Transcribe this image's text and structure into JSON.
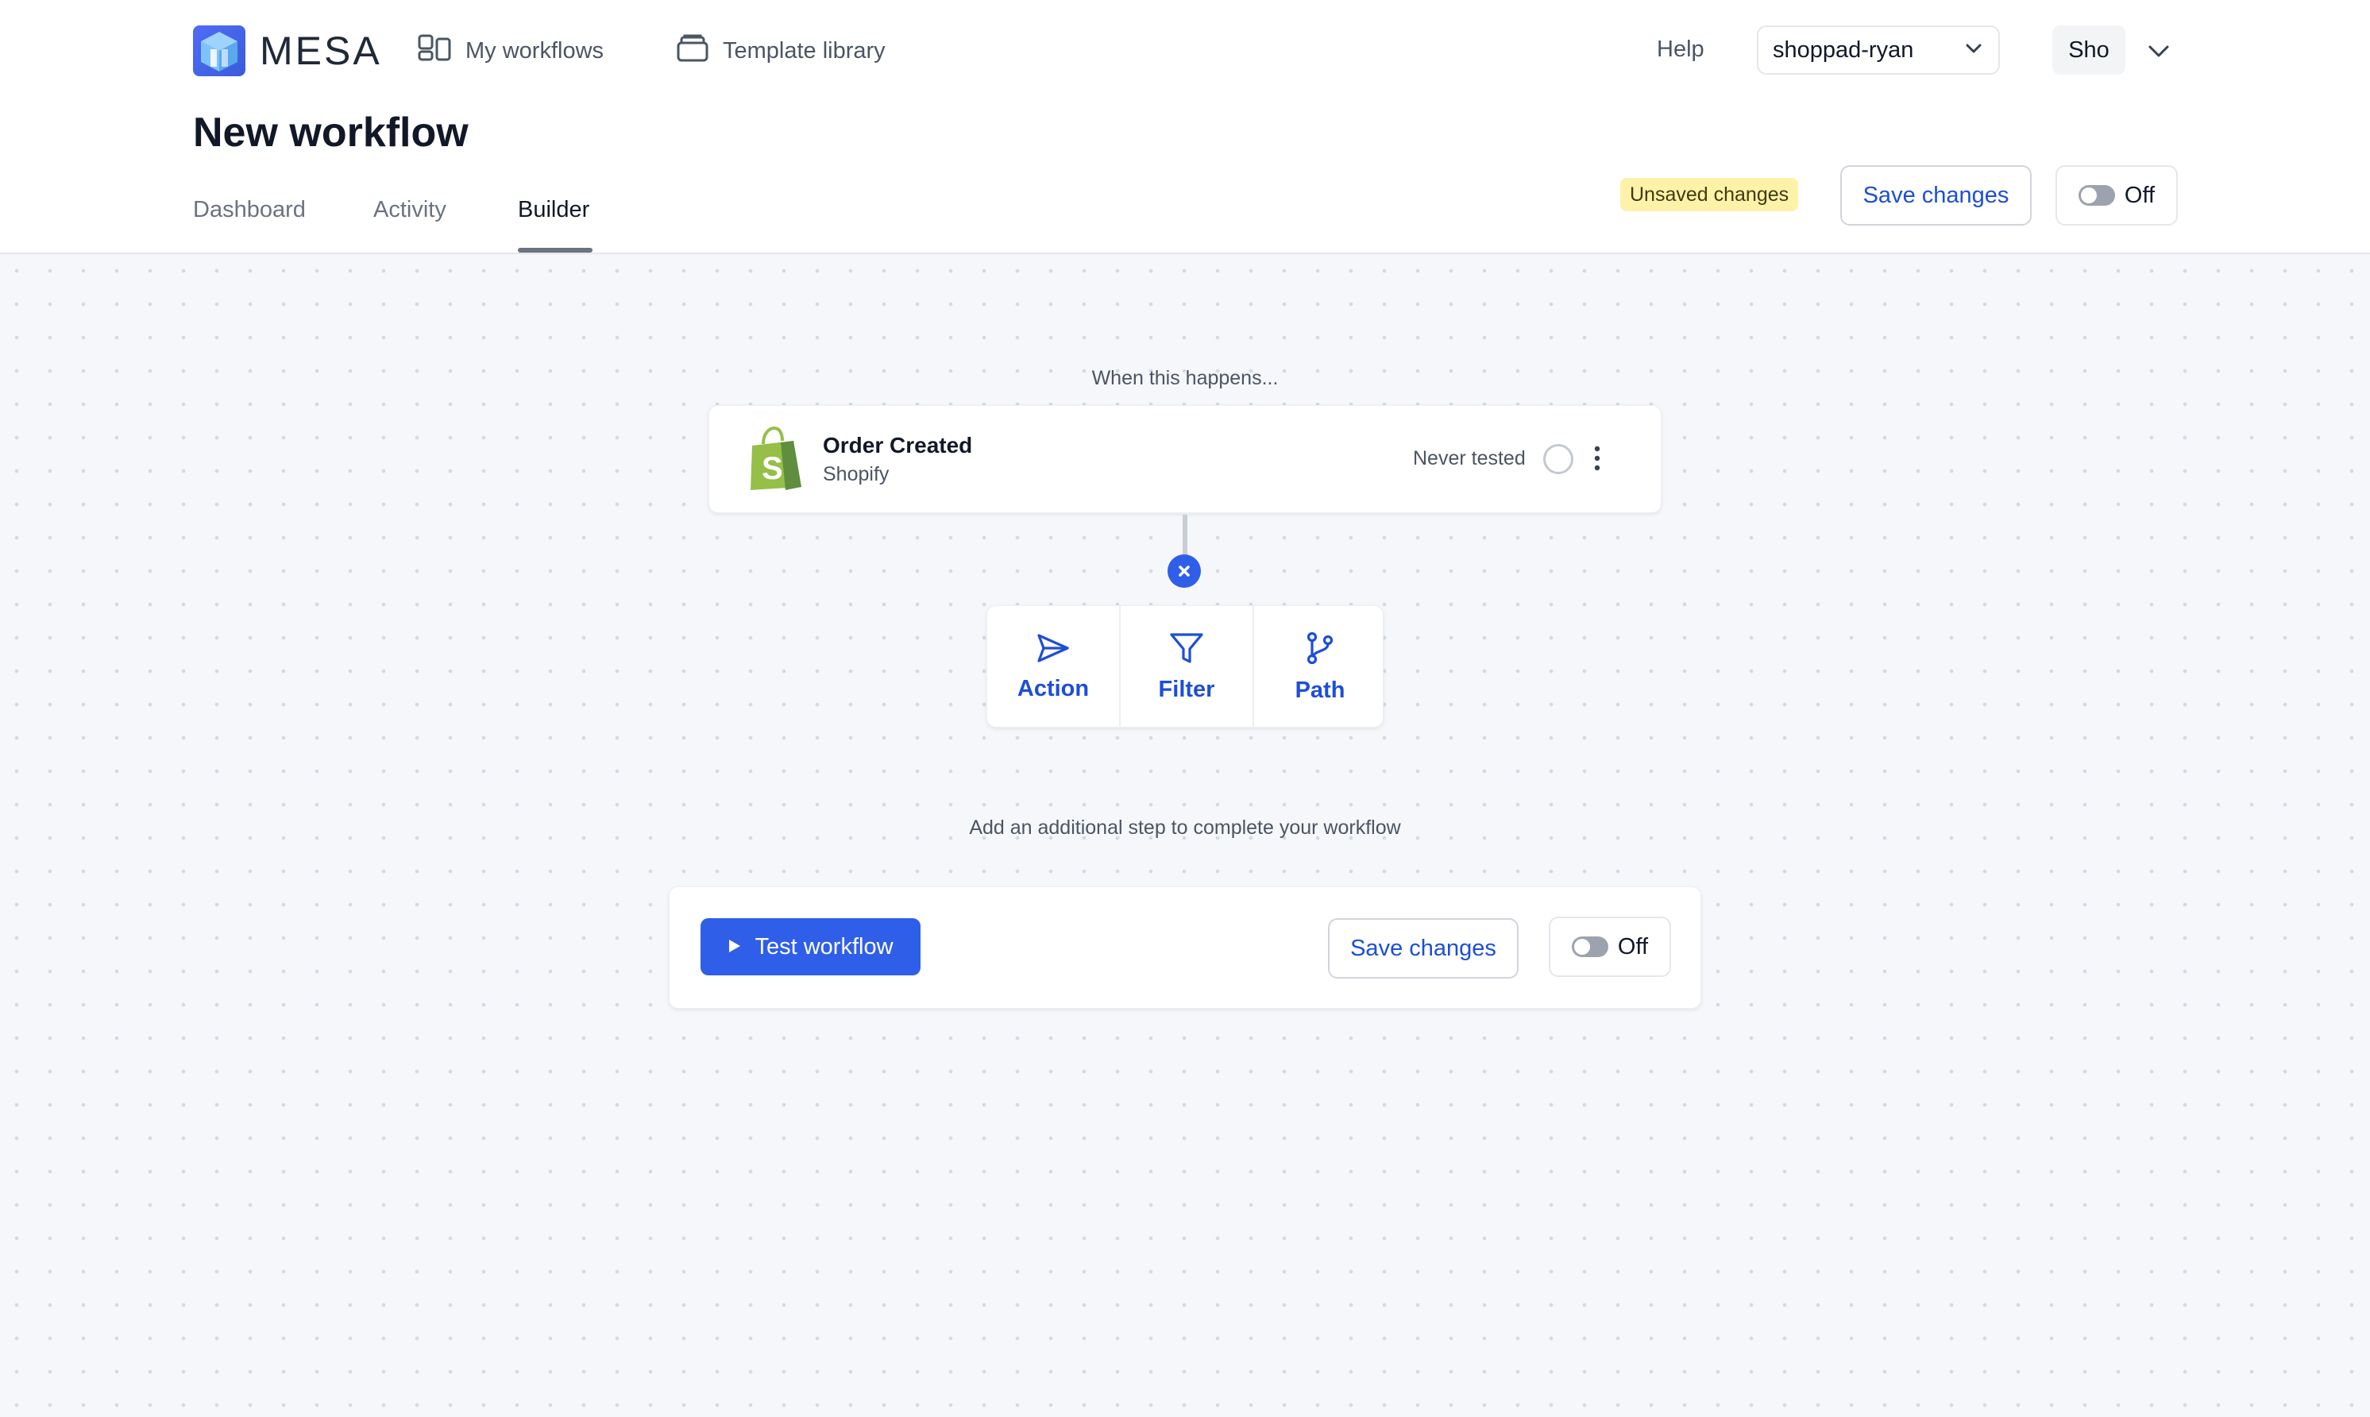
{
  "app": {
    "name": "MESA"
  },
  "nav": {
    "my_workflows": "My workflows",
    "template_library": "Template library",
    "help": "Help",
    "store": "shoppad-ryan",
    "user": "Sho"
  },
  "page": {
    "title": "New workflow"
  },
  "tabs": [
    {
      "label": "Dashboard"
    },
    {
      "label": "Activity"
    },
    {
      "label": "Builder"
    }
  ],
  "active_tab": "Builder",
  "header_actions": {
    "unsaved_badge": "Unsaved changes",
    "save_label": "Save changes",
    "toggle_label": "Off"
  },
  "builder": {
    "trigger_caption": "When this happens...",
    "trigger": {
      "title": "Order Created",
      "app": "Shopify",
      "status": "Never tested"
    },
    "steps": [
      {
        "label": "Action",
        "icon": "send-icon"
      },
      {
        "label": "Filter",
        "icon": "filter-icon"
      },
      {
        "label": "Path",
        "icon": "branch-icon"
      }
    ],
    "hint": "Add an additional step to complete your workflow"
  },
  "footer_actions": {
    "test_label": "Test workflow",
    "save_label": "Save changes",
    "toggle_label": "Off"
  },
  "colors": {
    "primary": "#2f5fe8",
    "link": "#1d4ed8",
    "badge_bg": "#fdf2a8",
    "shopify_green": "#95bf47"
  }
}
